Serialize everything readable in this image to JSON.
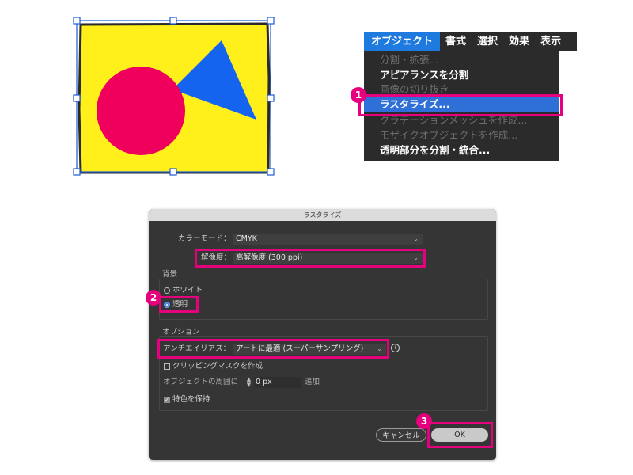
{
  "menubar": {
    "items": [
      "オブジェクト",
      "書式",
      "選択",
      "効果",
      "表示"
    ]
  },
  "menu": {
    "items": [
      {
        "label": "分割・拡張...",
        "enabled": false
      },
      {
        "label": "アピアランスを分割",
        "enabled": true
      },
      {
        "label": "画像の切り抜き",
        "enabled": false
      },
      {
        "label": "ラスタライズ...",
        "enabled": true,
        "highlighted": true
      },
      {
        "label": "グラデーションメッシュを作成...",
        "enabled": false
      },
      {
        "label": "モザイクオブジェクトを作成...",
        "enabled": false
      },
      {
        "label": "透明部分を分割・統合...",
        "enabled": true
      }
    ]
  },
  "callouts": {
    "step1": "1",
    "step2": "2",
    "step3": "3"
  },
  "dialog": {
    "title": "ラスタライズ",
    "color_mode_label": "カラーモード：",
    "color_mode_value": "CMYK",
    "resolution_label": "解像度：",
    "resolution_value": "高解像度 (300 ppi)",
    "background_label": "背景",
    "background_white": "ホワイト",
    "background_transparent": "透明",
    "background_selected": "透明",
    "options_label": "オプション",
    "antialias_label": "アンチエイリアス：",
    "antialias_value": "アートに最適 (スーパーサンプリング)",
    "clipping_mask_label": "クリッピングマスクを作成",
    "clipping_mask_checked": false,
    "margin_label": "オブジェクトの周囲に",
    "margin_value": "0 px",
    "margin_suffix": "追加",
    "preserve_spot_label": "特色を保持",
    "preserve_spot_checked": true,
    "cancel_label": "キャンセル",
    "ok_label": "OK"
  },
  "colors": {
    "accent_magenta": "#e5007e",
    "menu_bg": "#2b2b2b",
    "menu_highlight": "#2e6fd8",
    "dialog_bg": "#353535",
    "art_yellow": "#ffef1a",
    "art_pink": "#f0005d",
    "art_blue": "#1464f0",
    "selection_blue": "#1b5bd8"
  }
}
